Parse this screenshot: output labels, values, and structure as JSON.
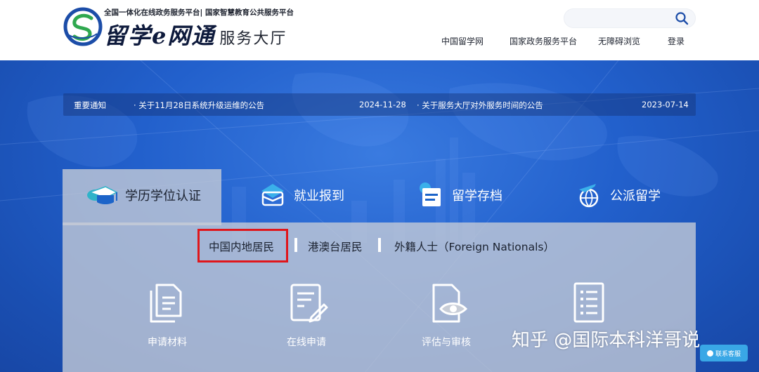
{
  "header": {
    "subtitle": "全国一体化在线政务服务平台| 国家智慧教育公共服务平台",
    "brand": "留学e网通",
    "hall": "服务大厅",
    "search": {
      "placeholder": ""
    },
    "nav": [
      "中国留学网",
      "国家政务服务平台",
      "无障碍浏览",
      "登录"
    ]
  },
  "notice": {
    "label": "重要通知",
    "items": [
      {
        "title": "· 关于11月28日系统升级运维的公告",
        "date": "2024-11-28"
      },
      {
        "title": "· 关于服务大厅对外服务时间的公告",
        "date": "2023-07-14"
      }
    ]
  },
  "tabs": [
    {
      "label": "学历学位认证",
      "icon": "graduation-cap-icon",
      "active": true
    },
    {
      "label": "就业报到",
      "icon": "briefcase-icon",
      "active": false
    },
    {
      "label": "留学存档",
      "icon": "archive-folder-icon",
      "active": false
    },
    {
      "label": "公派留学",
      "icon": "airplane-globe-icon",
      "active": false
    }
  ],
  "subtabs": [
    "中国内地居民",
    "港澳台居民",
    "外籍人士（Foreign Nationals）"
  ],
  "services": [
    {
      "label": "申请材料",
      "icon": "documents-icon"
    },
    {
      "label": "在线申请",
      "icon": "online-form-icon"
    },
    {
      "label": "评估与审核",
      "icon": "document-eye-icon"
    },
    {
      "label": "",
      "icon": "checklist-icon"
    }
  ],
  "watermark": "知乎 @国际本科洋哥说",
  "support_label": "联系客服",
  "colors": {
    "accent_blue": "#2260cc",
    "highlight_red": "#e0161b",
    "panel_gray": "#c8cdd7"
  }
}
